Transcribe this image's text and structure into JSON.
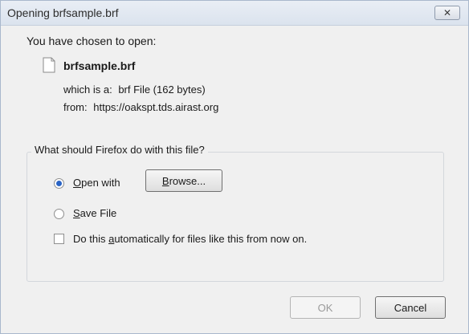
{
  "window": {
    "title": "Opening brfsample.brf",
    "close_glyph": "✕"
  },
  "intro": {
    "heading": "You have chosen to open:"
  },
  "file": {
    "name": "brfsample.brf",
    "icon": "file-icon",
    "type_label": "which is a:",
    "type_value": "brf File (162 bytes)",
    "from_label": "from:",
    "from_value": "https://oakspt.tds.airast.org"
  },
  "action_group": {
    "legend": "What should Firefox do with this file?",
    "open_with": {
      "prefix": "",
      "accel": "O",
      "rest": "pen with",
      "selected": true
    },
    "save_file": {
      "accel": "S",
      "rest": "ave File",
      "selected": false
    },
    "browse_button": {
      "accel": "B",
      "rest": "rowse..."
    },
    "auto": {
      "pre": "Do this ",
      "accel": "a",
      "rest": "utomatically for files like this from now on.",
      "checked": false
    }
  },
  "buttons": {
    "ok": "OK",
    "cancel": "Cancel"
  },
  "colors": {
    "radio_selected": "#2a64c5",
    "title_bar": "#dbe3ee",
    "background": "#f0f0f0"
  }
}
